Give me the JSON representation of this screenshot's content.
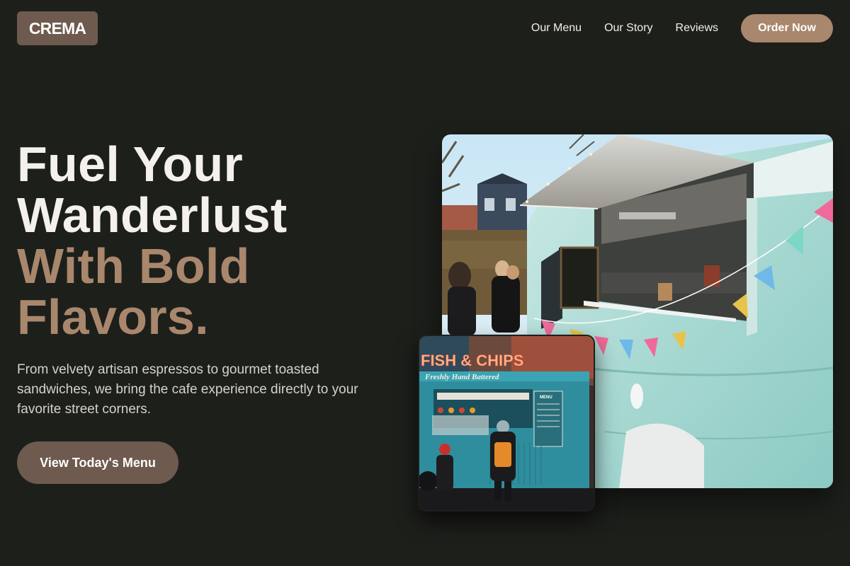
{
  "brand": {
    "logo": "CREMA"
  },
  "nav": {
    "links": [
      "Our Menu",
      "Our Story",
      "Reviews"
    ],
    "order_label": "Order Now"
  },
  "hero": {
    "title_lines": [
      "Fuel Your",
      "Wanderlust"
    ],
    "accent_lines": [
      "With Bold",
      "Flavors."
    ],
    "subtitle": "From velvety artisan espressos to gourmet toasted sandwiches, we bring the cafe experience directly to your favorite street corners.",
    "cta_label": "View Today's Menu"
  },
  "images": {
    "main": {
      "subject": "Mint-green vintage food truck with open serving hatch, bunting flags and customers"
    },
    "secondary": {
      "subject": "Teal fish and chips food truck with customers at the window",
      "sign_text": "FISH & CHIPS",
      "sub_sign_text": "Freshly Hand Battered",
      "menu_text": "MENU"
    }
  },
  "colors": {
    "background": "#1d1f1b",
    "accent": "#a9876c",
    "brand_dark": "#6e5a4e",
    "text": "#f4f1ec"
  }
}
